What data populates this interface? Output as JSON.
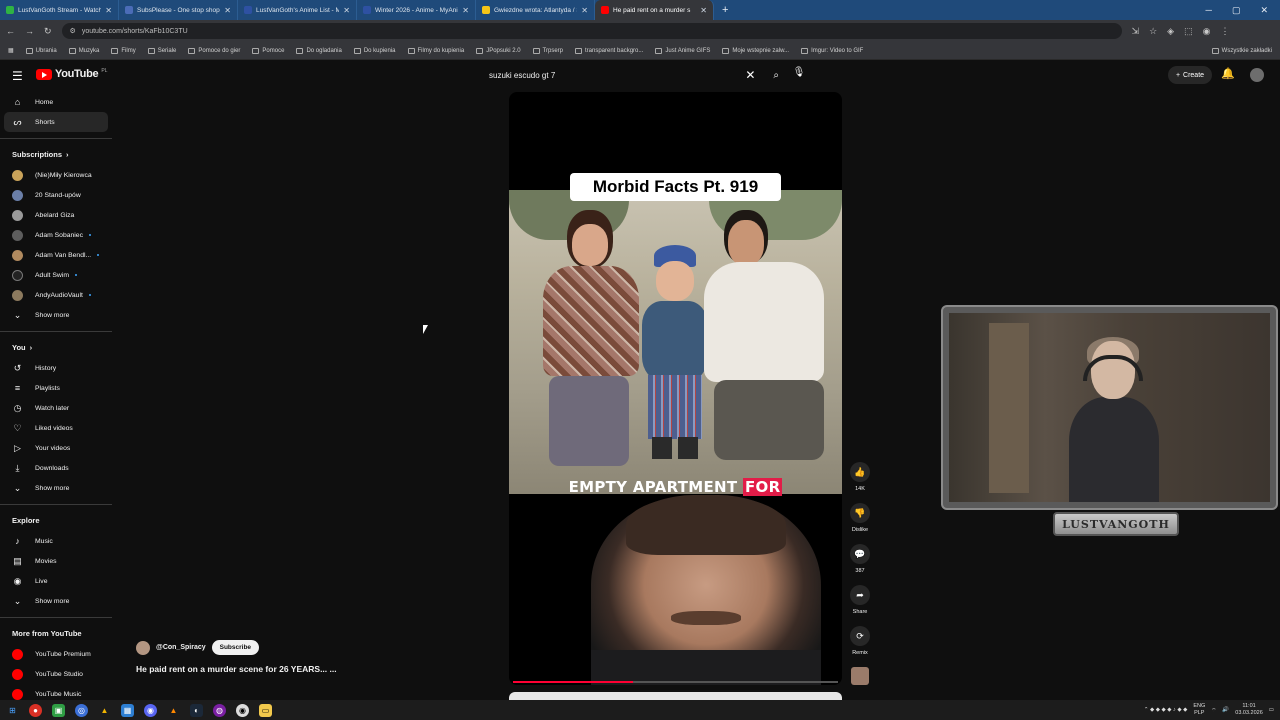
{
  "browser": {
    "tabs": [
      {
        "label": "LustVanGoth Stream - Watch Li",
        "color": "#2fb344"
      },
      {
        "label": "SubsPlease - One stop shop fo",
        "color": "#4b6cb7"
      },
      {
        "label": "LustVanGoth's Anime List - My",
        "color": "#2e51a2"
      },
      {
        "label": "Winter 2026 - Anime - MyAnim",
        "color": "#2e51a2"
      },
      {
        "label": "Gwiezdne wrota: Atlantyda / St",
        "color": "#f5c518"
      },
      {
        "label": "He paid rent on a murder s",
        "color": "#ff0000"
      }
    ],
    "url": "youtube.com/shorts/KaFb10C3TU",
    "bookmarks": [
      "Ubrania",
      "Muzyka",
      "Filmy",
      "Seriale",
      "Pomoce do gier",
      "Pomoce",
      "Do ogladania",
      "Do kupienia",
      "Filmy do kupienia",
      "JPopsuki 2.0",
      "Trpserp",
      "transparent backgro...",
      "Just Anime GIFS",
      "Moje wstepnie zalw...",
      "Imgur: Video to GIF"
    ],
    "bookmarks_right": "Wszystkie zakładki"
  },
  "masthead": {
    "logo_text": "YouTube",
    "country": "PL",
    "search_value": "suzuki escudo gt 7",
    "create_label": "Create"
  },
  "sidebar": {
    "main": [
      {
        "label": "Home",
        "icon": "home-icon"
      },
      {
        "label": "Shorts",
        "icon": "shorts-icon"
      }
    ],
    "subscriptions_title": "Subscriptions",
    "subscriptions": [
      {
        "label": "(Nie)Miły Kierowca",
        "color": "#c9a35a",
        "dot": false
      },
      {
        "label": "20 Stand-upów",
        "color": "#6b7fa8",
        "dot": false
      },
      {
        "label": "Abelard Giza",
        "color": "#9a9a9a",
        "dot": false
      },
      {
        "label": "Adam Sobaniec",
        "color": "#5d5d5d",
        "dot": true
      },
      {
        "label": "Adam Van Bendl...",
        "color": "#b08a5f",
        "dot": true
      },
      {
        "label": "Adult Swim",
        "color": "#222222",
        "dot": true
      },
      {
        "label": "AndyAudioVault",
        "color": "#8c7a5e",
        "dot": true
      }
    ],
    "show_more": "Show more",
    "you_title": "You",
    "you_items": [
      {
        "label": "History",
        "icon": "history-icon"
      },
      {
        "label": "Playlists",
        "icon": "playlists-icon"
      },
      {
        "label": "Watch later",
        "icon": "watch-later-icon"
      },
      {
        "label": "Liked videos",
        "icon": "liked-videos-icon"
      },
      {
        "label": "Your videos",
        "icon": "your-videos-icon"
      },
      {
        "label": "Downloads",
        "icon": "downloads-icon"
      }
    ],
    "explore_title": "Explore",
    "explore_items": [
      {
        "label": "Music",
        "icon": "music-icon"
      },
      {
        "label": "Movies",
        "icon": "movies-icon"
      },
      {
        "label": "Live",
        "icon": "live-icon"
      }
    ],
    "more_title": "More from YouTube",
    "more_items": [
      {
        "label": "YouTube Premium"
      },
      {
        "label": "YouTube Studio"
      },
      {
        "label": "YouTube Music"
      }
    ]
  },
  "short": {
    "title_card": "Morbid Facts Pt. 919",
    "caption_main": "EMPTY APARTMENT ",
    "caption_highlight": "FOR",
    "progress": 0.37,
    "channel": "@Con_Spiracy",
    "subscribe_label": "Subscribe",
    "video_title": "He paid rent on a murder scene for 26 YEARS... ..."
  },
  "actions": [
    {
      "label": "14K",
      "icon": "like-icon"
    },
    {
      "label": "Dislike",
      "icon": "dislike-icon"
    },
    {
      "label": "387",
      "icon": "comments-icon"
    },
    {
      "label": "Share",
      "icon": "share-icon"
    },
    {
      "label": "Remix",
      "icon": "remix-icon"
    }
  ],
  "webcam": {
    "banner": "LUSTVANGOTH"
  },
  "taskbar": {
    "lang": "ENG",
    "lang2": "PLP",
    "time": "11:01",
    "date": "03.03.2026"
  }
}
